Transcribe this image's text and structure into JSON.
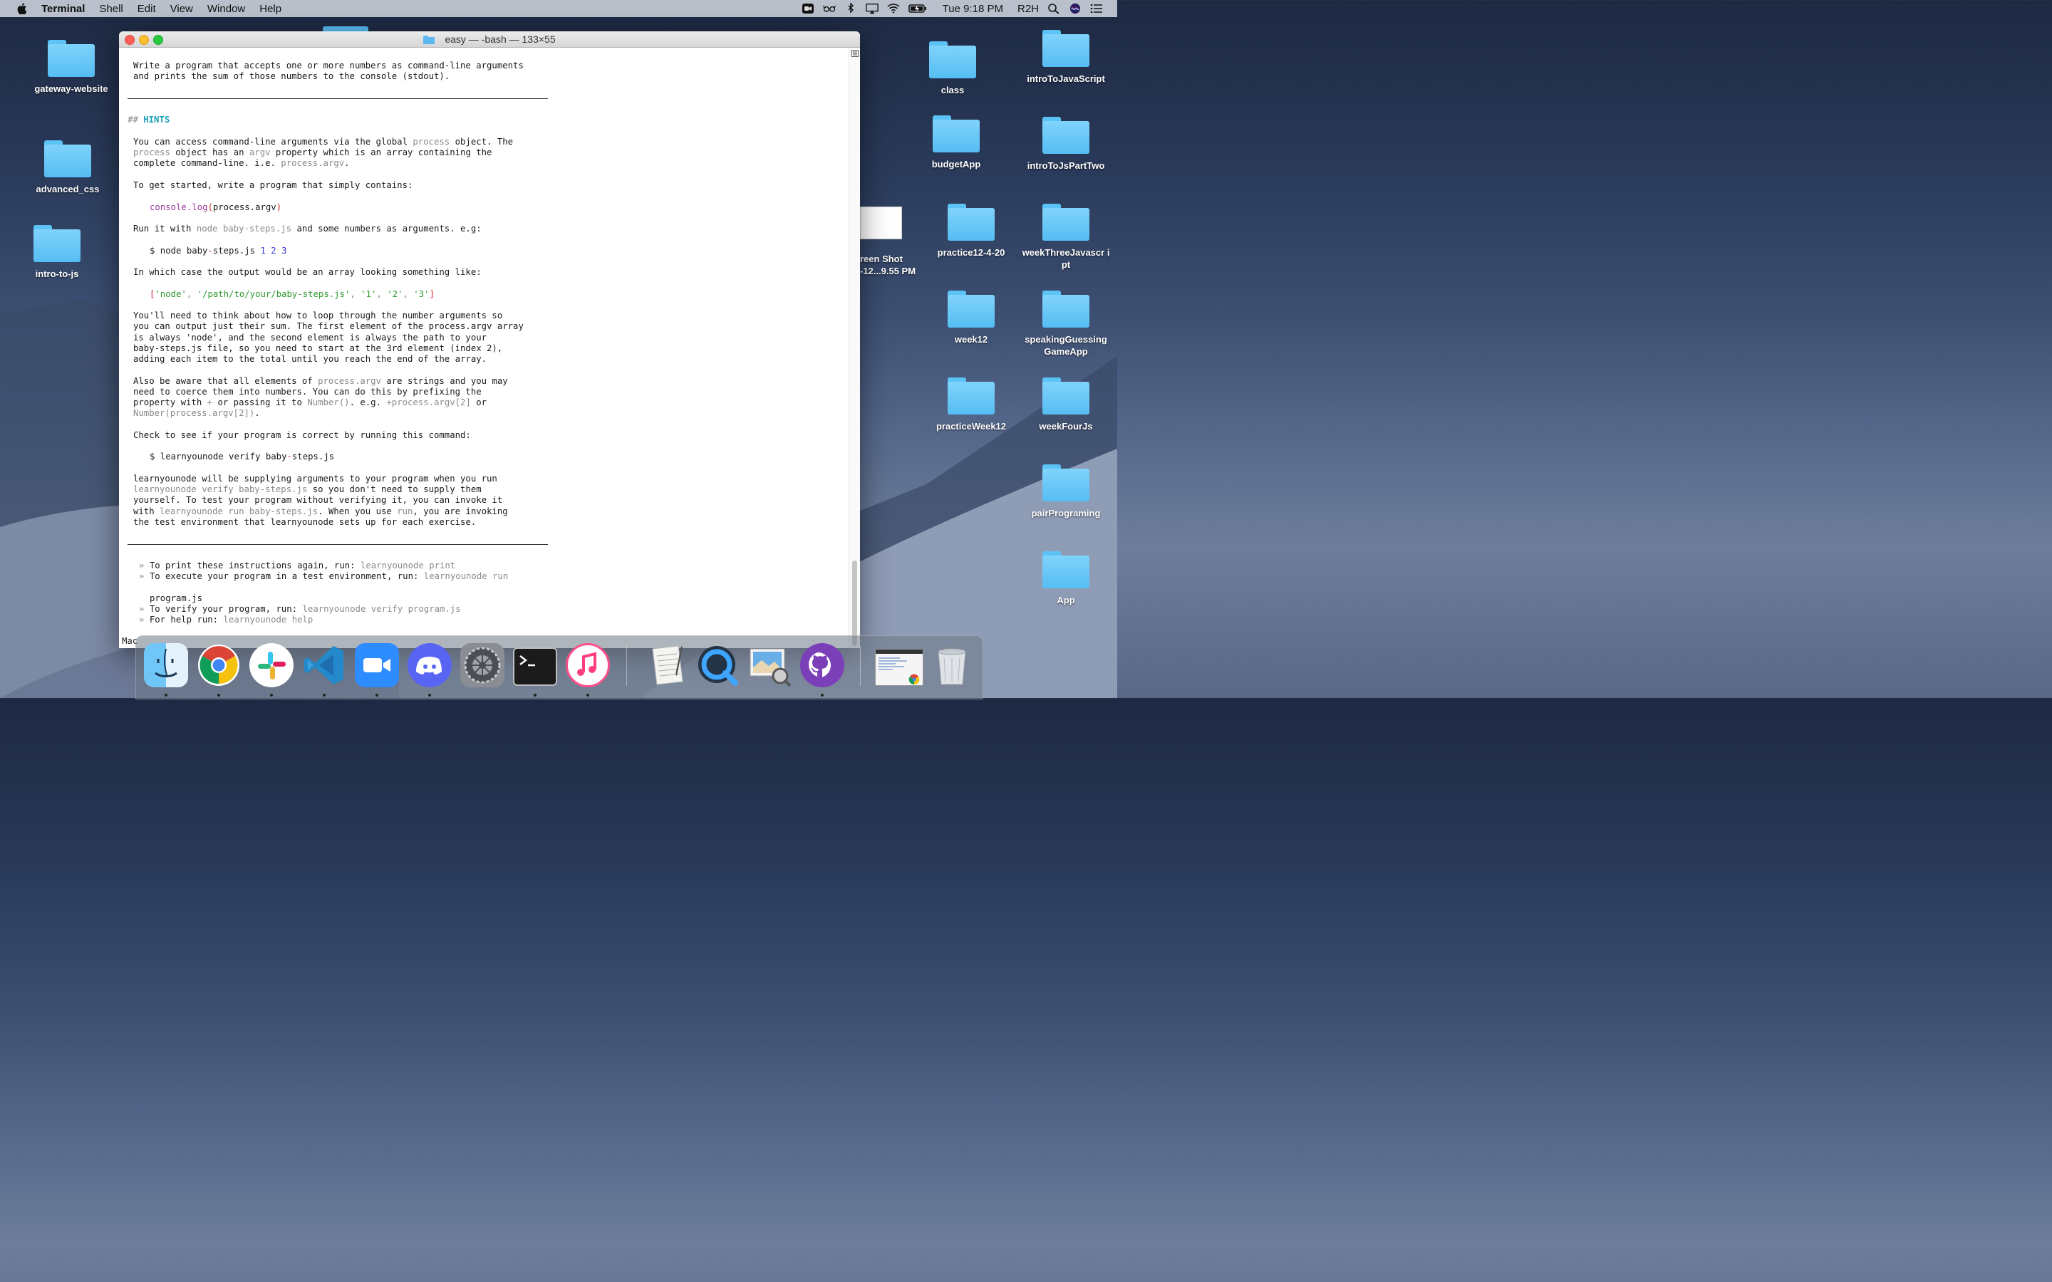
{
  "menubar": {
    "app_name": "Terminal",
    "menus": [
      "Shell",
      "Edit",
      "View",
      "Window",
      "Help"
    ],
    "clock": "Tue 9:18 PM",
    "user": "R2H"
  },
  "window": {
    "title": "easy — -bash — 133×55"
  },
  "terminal": {
    "intro1": "Write a program that accepts one or more numbers as command-line arguments",
    "intro2": "and prints the sum of those numbers to the console (stdout).",
    "hints_prefix": "## ",
    "hints_title": "HINTS",
    "p1a": "You can access command-line arguments via the global ",
    "p1b": "process",
    "p1c": " object. The",
    "p1d": "process",
    "p1e": " object has an ",
    "p1f": "argv",
    "p1g": " property which is an array containing the",
    "p1h": "complete command-line. i.e. ",
    "p1i": "process.argv",
    "p1j": ".",
    "p2": "To get started, write a program that simply contains:",
    "code1a": "console.log",
    "code1b": "(",
    "code1c": "process.argv",
    "code1d": ")",
    "p3a": "Run it with ",
    "p3b": "node baby-steps.js",
    "p3c": " and some numbers as arguments. e.g:",
    "cmd1a": "$ node baby",
    "cmd1b": "-",
    "cmd1c": "steps.js ",
    "cmd1d": "1 2 3",
    "p4": "In which case the output would be an array looking something like:",
    "arr_open": "[",
    "arr_1": "'node'",
    "arr_sep": ", ",
    "arr_2": "'/path/to/your/baby-steps.js'",
    "arr_3": "'1'",
    "arr_4": "'2'",
    "arr_5": "'3'",
    "arr_close": "]",
    "p5_1": "You'll need to think about how to loop through the number arguments so",
    "p5_2": "you can output just their sum. The first element of the process.argv array",
    "p5_3": "is always 'node', and the second element is always the path to your",
    "p5_4": "baby-steps.js file, so you need to start at the 3rd element (index 2),",
    "p5_5": "adding each item to the total until you reach the end of the array.",
    "p6_1a": "Also be aware that all elements of ",
    "p6_1b": "process.argv",
    "p6_1c": " are strings and you may",
    "p6_2": "need to coerce them into numbers. You can do this by prefixing the",
    "p6_3a": "property with ",
    "p6_3b": "+",
    "p6_3c": " or passing it to ",
    "p6_3d": "Number()",
    "p6_3e": ". e.g. ",
    "p6_3f": "+process.argv[2]",
    "p6_3g": " or",
    "p6_4a": "Number(process.argv[2])",
    "p6_4b": ".",
    "p7": "Check to see if your program is correct by running this command:",
    "cmd2a": "$ learnyounode verify baby",
    "cmd2b": "-",
    "cmd2c": "steps.js",
    "p8_1": "learnyounode will be supplying arguments to your program when you run",
    "p8_2a": "learnyounode verify baby-steps.js",
    "p8_2b": " so you don't need to supply them",
    "p8_3": "yourself. To test your program without verifying it, you can invoke it",
    "p8_4a": "with ",
    "p8_4b": "learnyounode run baby-steps.js",
    "p8_4c": ". When you use ",
    "p8_4d": "run",
    "p8_4e": ", you are invoking",
    "p8_5": "the test environment that learnyounode sets up for each exercise.",
    "bullet": "»",
    "f1a": "To print these instructions again, run: ",
    "f1b": "learnyounode print",
    "f2a": "To execute your program in a test environment, run: ",
    "f2b": "learnyounode run",
    "f3": "program.js",
    "f4a": "To verify your program, run: ",
    "f4b": "learnyounode verify program.js",
    "f5a": "For help run: ",
    "f5b": "learnyounode help",
    "prompt_partial": "Mac"
  },
  "desktop_left": [
    {
      "label": "gateway-website"
    },
    {
      "label": "advanced_css"
    },
    {
      "label": "intro-to-js"
    }
  ],
  "desktop_right": [
    {
      "label": "class"
    },
    {
      "label": "introToJavaScript"
    },
    {
      "label": "budgetApp"
    },
    {
      "label": "introToJsPartTwo"
    },
    {
      "label": "practice12-4-20"
    },
    {
      "label": "weekThreeJavascr ipt"
    },
    {
      "label": "week12"
    },
    {
      "label": "speakingGuessing GameApp"
    },
    {
      "label": "practiceWeek12"
    },
    {
      "label": "weekFourJs"
    },
    {
      "label": "pairPrograming"
    },
    {
      "label": "App"
    }
  ],
  "screenshot_file": {
    "line1": "reen Shot",
    "line2": "-12...9.55 PM"
  },
  "dock": [
    "finder-icon",
    "chrome-icon",
    "slack-icon",
    "vscode-icon",
    "zoom-icon",
    "discord-icon",
    "system-preferences-icon",
    "terminal-icon",
    "itunes-icon",
    "textedit-icon",
    "quicktime-icon",
    "preview-icon",
    "github-desktop-icon",
    "minimized-window-icon",
    "trash-icon"
  ],
  "colors": {
    "folder": "#56bdf3",
    "hints": "#1ba0b8",
    "numbers": "#3b3bd8",
    "string": "#2f9a2f",
    "bracket": "#d02d2d"
  }
}
